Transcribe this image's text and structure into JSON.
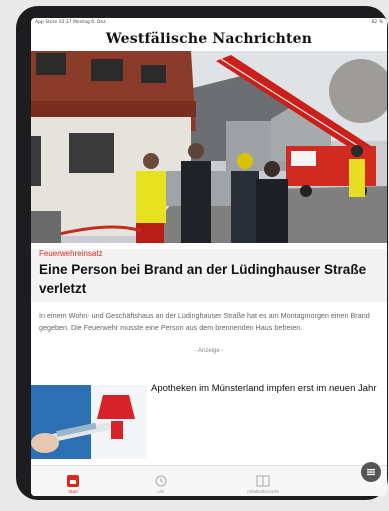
{
  "status_bar": {
    "left": "App Store 10:37 Montag 6. Dez.",
    "right": "62 %"
  },
  "masthead": {
    "title": "Westfälische Nachrichten"
  },
  "lead_article": {
    "kicker": "Feuerwehreinsatz",
    "headline": "Eine Person bei Brand an der Lüdinghauser Straße verletzt",
    "teaser": "In einem Wohn- und Geschäftshaus an der Lüdinghauser Straße hat es am Montagmorgen einen Brand gegeben. Die Feuerwehr musste eine Person aus dem brennenden Haus befreien."
  },
  "ad_label": "- Anzeige -",
  "second_article": {
    "headline": "Apotheken im Münsterland impfen erst im neuen Jahr"
  },
  "tab_bar": {
    "tabs": [
      {
        "label": "Start",
        "icon": "home-icon",
        "active": true
      },
      {
        "label": "Uhr",
        "icon": "clock-icon",
        "active": false
      },
      {
        "label": "Inhaltsübersicht",
        "icon": "contents-icon",
        "active": false
      }
    ]
  },
  "colors": {
    "accent": "#d92b1c",
    "device": "#1d1d1f"
  }
}
